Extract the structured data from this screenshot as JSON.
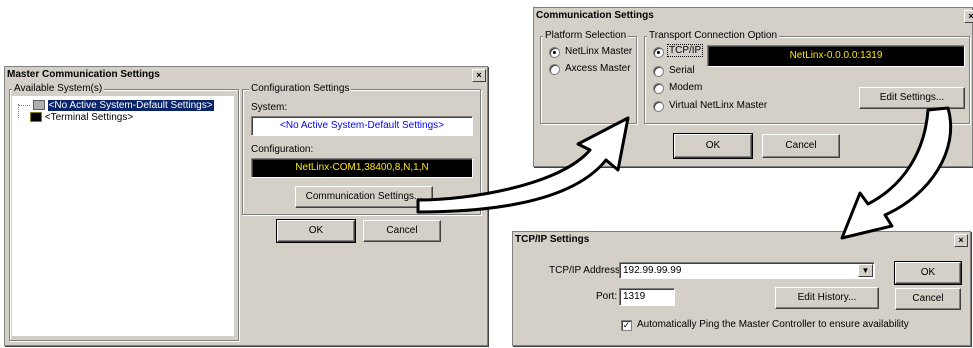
{
  "master": {
    "title": "Master Communication Settings",
    "close_glyph": "×",
    "available_label": "Available System(s)",
    "tree": [
      {
        "label": "<No Active System-Default Settings>",
        "selected": true
      },
      {
        "label": "<Terminal Settings>",
        "selected": false
      }
    ],
    "config_label": "Configuration Settings",
    "system_label": "System:",
    "system_value": "<No Active System-Default Settings>",
    "configuration_label": "Configuration:",
    "configuration_value": "NetLinx-COM1,38400,8,N,1,N",
    "comm_button": "Communication Settings...",
    "ok": "OK",
    "cancel": "Cancel"
  },
  "comm": {
    "title": "Communication Settings",
    "close_glyph": "×",
    "platform_label": "Platform Selection",
    "platform_options": [
      "NetLinx Master",
      "Axcess Master"
    ],
    "transport_label": "Transport Connection Option",
    "transport_options": [
      "TCP/IP",
      "Serial",
      "Modem",
      "Virtual NetLinx Master"
    ],
    "connection_value": "NetLinx-0.0.0.0:1319",
    "edit_settings": "Edit Settings...",
    "ok": "OK",
    "cancel": "Cancel"
  },
  "tcp": {
    "title": "TCP/IP Settings",
    "close_glyph": "×",
    "address_label": "TCP/IP Address:",
    "address_value": "192.99.99.99",
    "port_label": "Port:",
    "port_value": "1319",
    "edit_history": "Edit History...",
    "ok": "OK",
    "cancel": "Cancel",
    "ping_label": "Automatically Ping the Master Controller to ensure availability",
    "ping_checked": true
  }
}
